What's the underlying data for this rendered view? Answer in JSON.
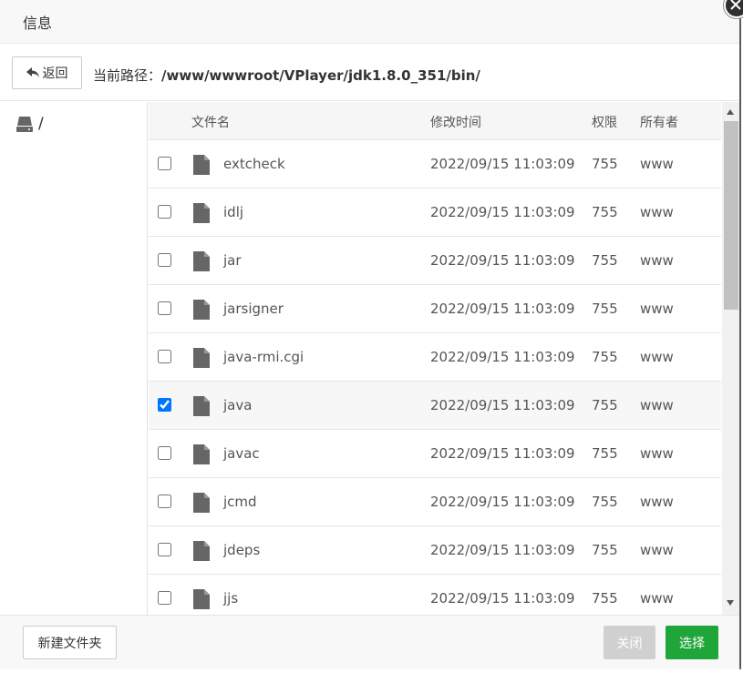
{
  "dialog": {
    "title": "信息"
  },
  "toolbar": {
    "back_label": "返回",
    "path_label": "当前路径：",
    "path_value": "/www/wwwroot/VPlayer/jdk1.8.0_351/bin/"
  },
  "sidebar": {
    "root_label": "/"
  },
  "table": {
    "headers": {
      "name": "文件名",
      "mtime": "修改时间",
      "perm": "权限",
      "owner": "所有者"
    },
    "rows": [
      {
        "name": "extcheck",
        "mtime": "2022/09/15 11:03:09",
        "perm": "755",
        "owner": "www",
        "checked": false
      },
      {
        "name": "idlj",
        "mtime": "2022/09/15 11:03:09",
        "perm": "755",
        "owner": "www",
        "checked": false
      },
      {
        "name": "jar",
        "mtime": "2022/09/15 11:03:09",
        "perm": "755",
        "owner": "www",
        "checked": false
      },
      {
        "name": "jarsigner",
        "mtime": "2022/09/15 11:03:09",
        "perm": "755",
        "owner": "www",
        "checked": false
      },
      {
        "name": "java-rmi.cgi",
        "mtime": "2022/09/15 11:03:09",
        "perm": "755",
        "owner": "www",
        "checked": false
      },
      {
        "name": "java",
        "mtime": "2022/09/15 11:03:09",
        "perm": "755",
        "owner": "www",
        "checked": true
      },
      {
        "name": "javac",
        "mtime": "2022/09/15 11:03:09",
        "perm": "755",
        "owner": "www",
        "checked": false
      },
      {
        "name": "jcmd",
        "mtime": "2022/09/15 11:03:09",
        "perm": "755",
        "owner": "www",
        "checked": false
      },
      {
        "name": "jdeps",
        "mtime": "2022/09/15 11:03:09",
        "perm": "755",
        "owner": "www",
        "checked": false
      },
      {
        "name": "jjs",
        "mtime": "2022/09/15 11:03:09",
        "perm": "755",
        "owner": "www",
        "checked": false
      }
    ]
  },
  "footer": {
    "new_folder_label": "新建文件夹",
    "close_label": "关闭",
    "select_label": "选择"
  },
  "colors": {
    "accent": "#20a53a",
    "disabled": "#d0d0d0"
  }
}
